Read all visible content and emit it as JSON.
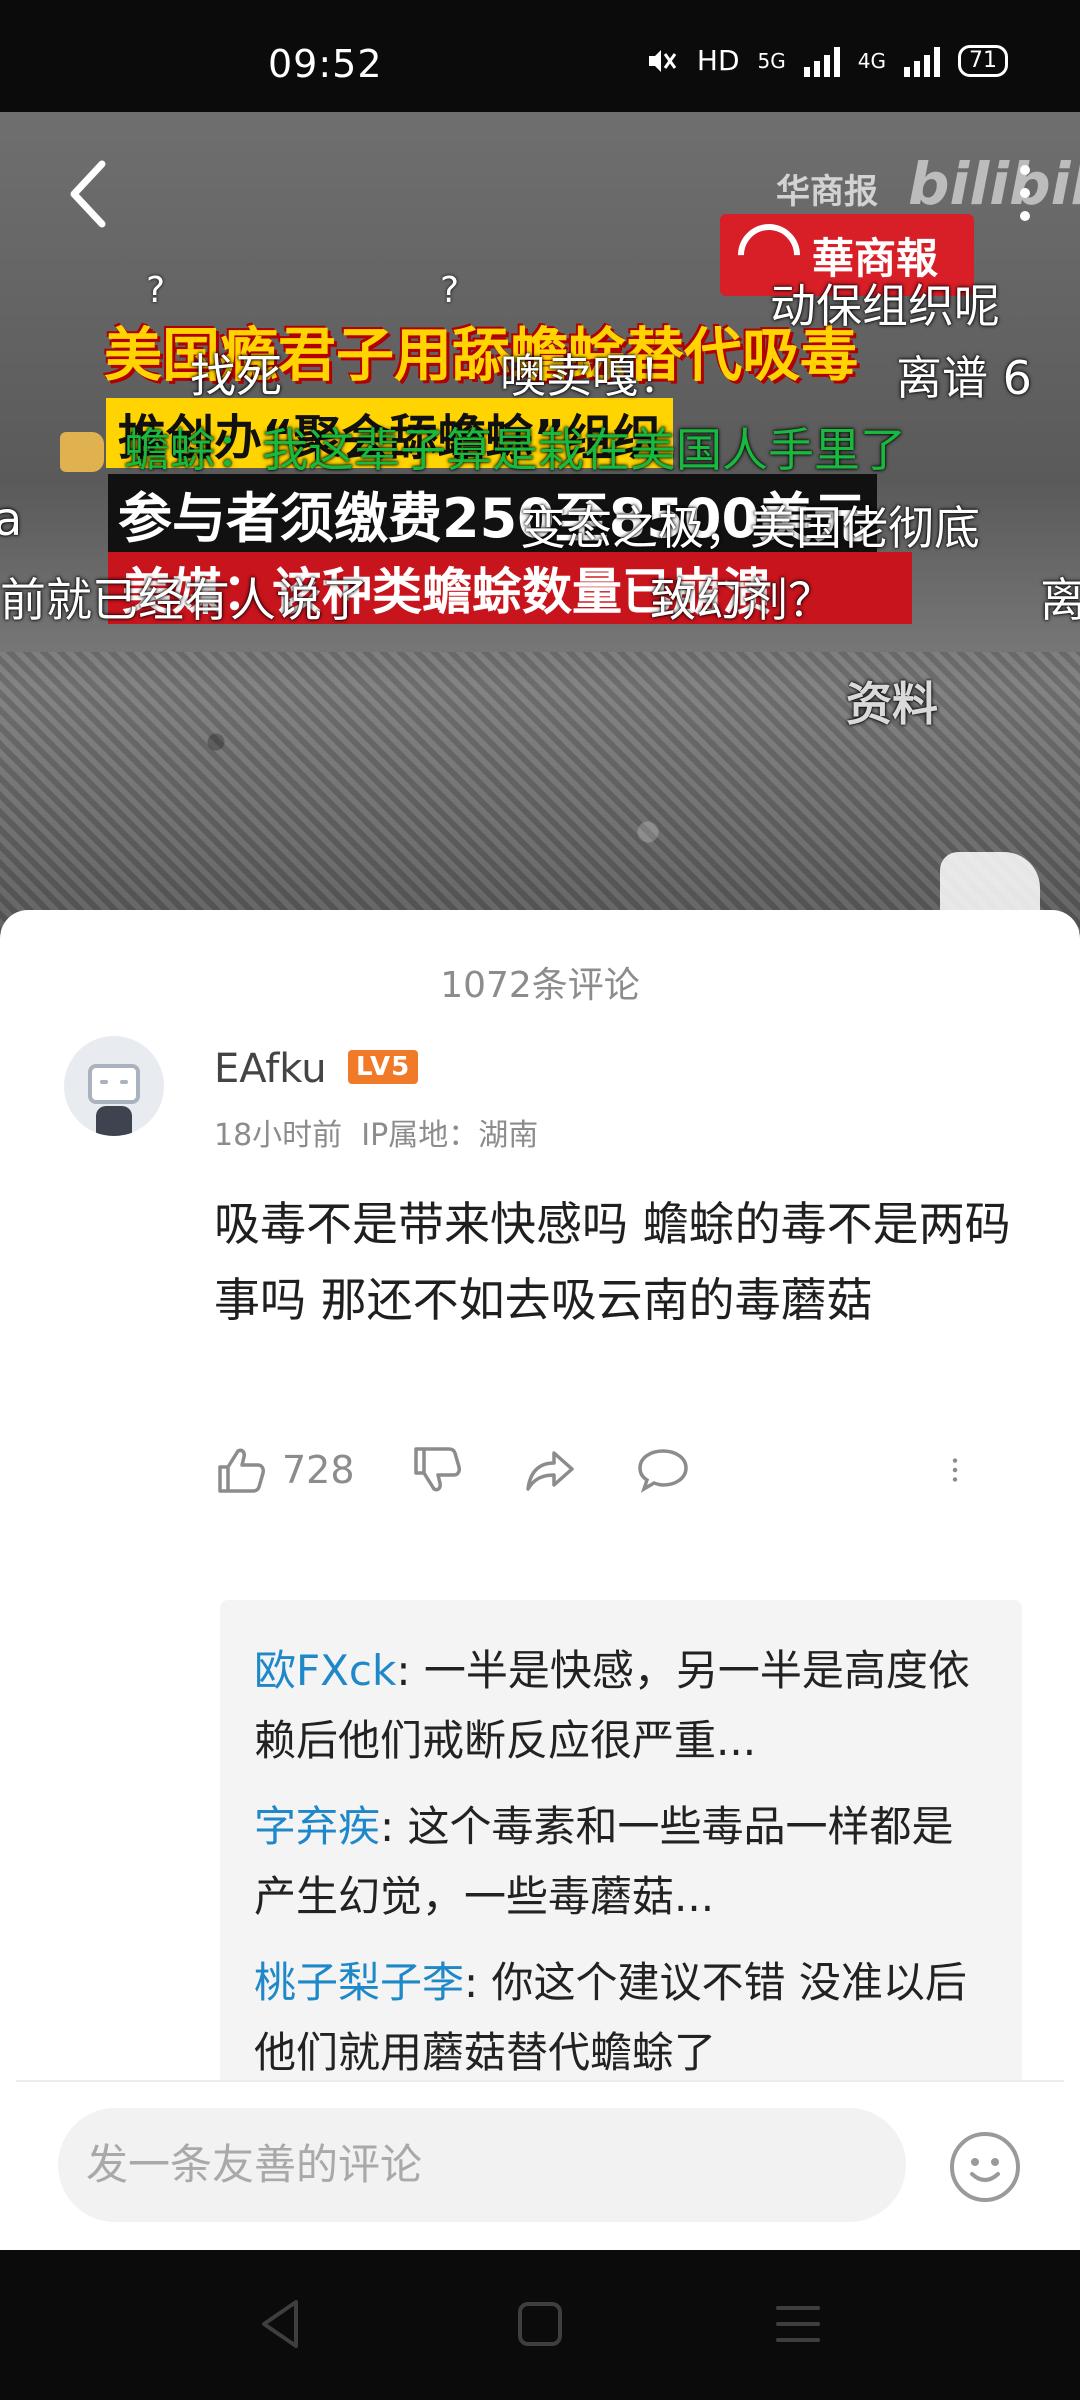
{
  "status_bar": {
    "time": "09:52",
    "network_hd": "HD",
    "network_5g": "5G",
    "network_4g": "4G",
    "battery": "71"
  },
  "video": {
    "watermark_text": "华商报",
    "watermark_logo": "bilibili",
    "news_logo": "華商報",
    "headline_1": "美国瘾君子用舔蟾蜍替代吸毒",
    "headline_2": "推创办“聚会舔蟾蜍”组织",
    "headline_3": "参与者须缴费250至8500美元",
    "headline_4": "美媒：该种类蟾蜍数量已崩溃",
    "side_label": "资料",
    "danmaku": [
      "找死",
      "噢卖嘎！",
      "动保组织呢",
      "离谱 6",
      "蟾蜍：我这辈子算是栽在美国人手里了",
      "变态之极，美国佬彻底",
      "前就已经有人说了",
      "致幻剂？",
      "离",
      "a"
    ]
  },
  "comments": {
    "count_label": "1072条评论",
    "main": {
      "username": "EAfku",
      "level": "LV5",
      "time": "18小时前",
      "ip": "IP属地：湖南",
      "text": "吸毒不是带来快感吗 蟾蜍的毒不是两码事吗 那还不如去吸云南的毒蘑菇",
      "likes": "728"
    },
    "replies": [
      {
        "name": "欧FXck",
        "text": ": 一半是快感，另一半是高度依赖后他们戒断反应很严重..."
      },
      {
        "name": "字弃疾",
        "text": ": 这个毒素和一些毒品一样都是产生幻觉，一些毒蘑菇..."
      },
      {
        "name": "桃子梨子李",
        "text": ": 你这个建议不错 没准以后他们就用蘑菇替代蟾蜍了"
      }
    ]
  },
  "input": {
    "placeholder": "发一条友善的评论"
  },
  "colors": {
    "accent_blue": "#1e88c8",
    "level_orange": "#f07a28",
    "news_red": "#d81e27"
  }
}
